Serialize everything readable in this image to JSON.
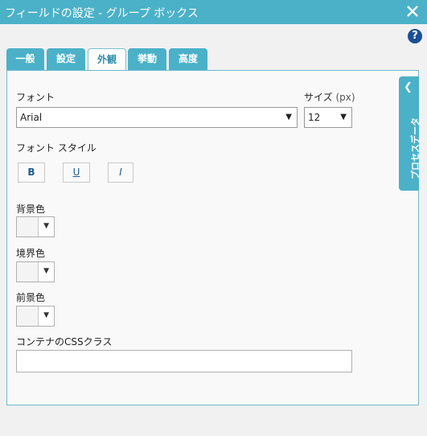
{
  "window": {
    "title": "フィールドの設定 - グループ ボックス"
  },
  "help_symbol": "?",
  "tabs": [
    {
      "label": "一般"
    },
    {
      "label": "設定"
    },
    {
      "label": "外観"
    },
    {
      "label": "挙動"
    },
    {
      "label": "高度"
    }
  ],
  "active_tab": "外観",
  "font": {
    "label": "フォント",
    "value": "Arial"
  },
  "size": {
    "label": "サイズ",
    "unit": "(px)",
    "value": "12"
  },
  "font_style": {
    "label": "フォント スタイル",
    "bold": "B",
    "underline": "U",
    "italic": "I"
  },
  "background_color": {
    "label": "背景色"
  },
  "border_color": {
    "label": "境界色"
  },
  "foreground_color": {
    "label": "前景色"
  },
  "container_css": {
    "label": "コンテナのCSSクラス",
    "value": ""
  },
  "side_panel": {
    "label": "プロセスデータ"
  },
  "colors": {
    "accent": "#4bb1c8",
    "help": "#1b4f96"
  }
}
